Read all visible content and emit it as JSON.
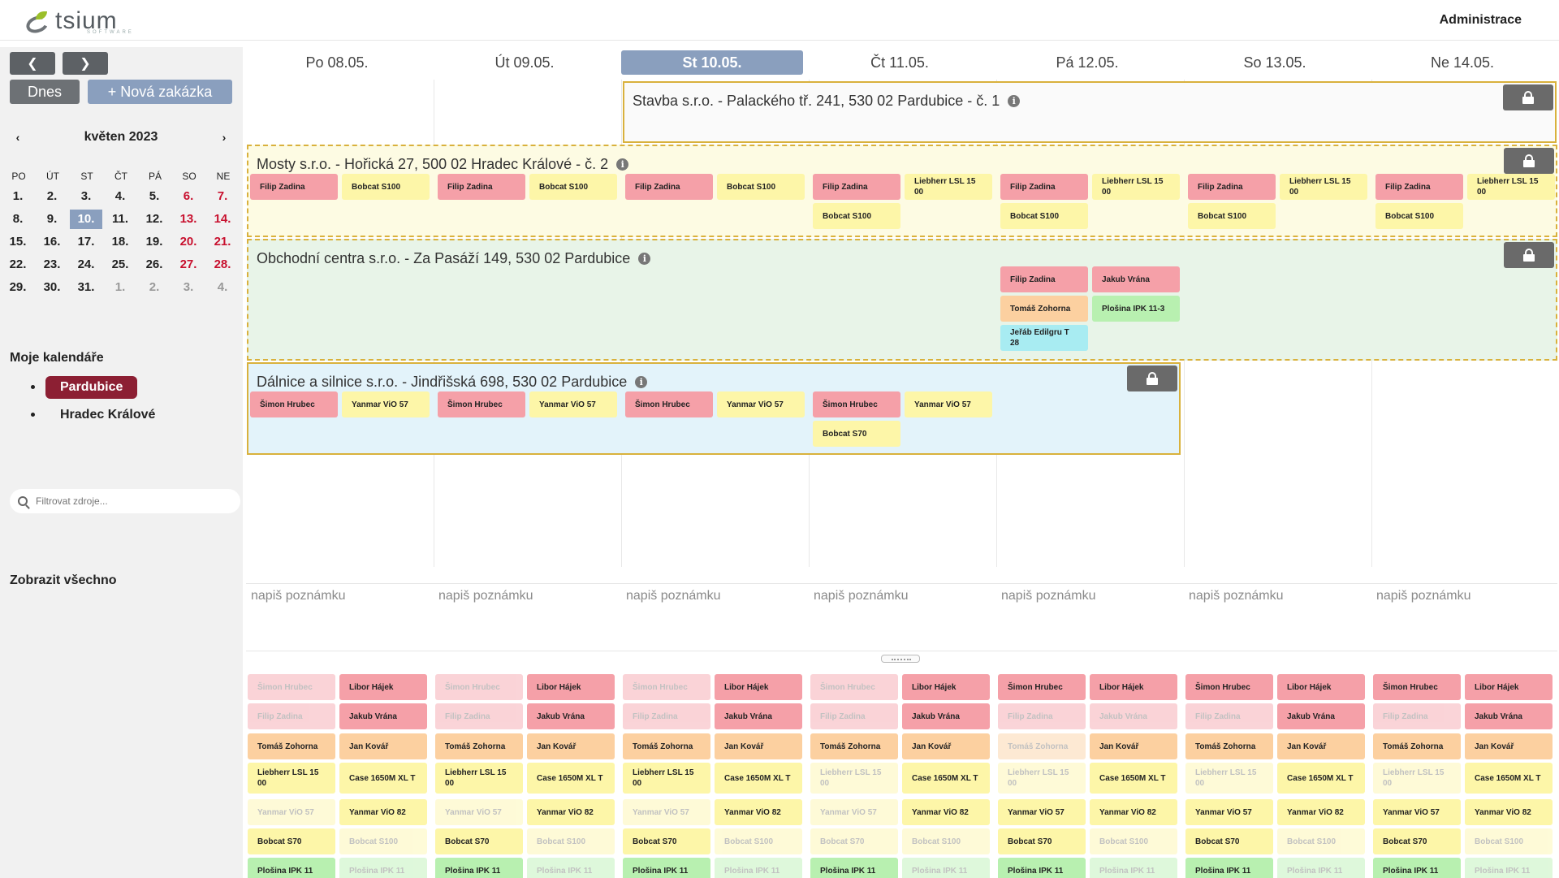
{
  "header": {
    "logo_text": "tsium",
    "logo_sub": "SOFTWARE",
    "admin": "Administrace"
  },
  "sidebar": {
    "prev_icon": "chevron-left-icon",
    "next_icon": "chevron-right-icon",
    "today_label": "Dnes",
    "new_order_label": "+ Nová zakázka",
    "month_title": "květen 2023",
    "weekdays": [
      "PO",
      "ÚT",
      "ST",
      "ČT",
      "PÁ",
      "SO",
      "NE"
    ],
    "days": [
      "1.",
      "2.",
      "3.",
      "4.",
      "5.",
      "6.",
      "7.",
      "8.",
      "9.",
      "10.",
      "11.",
      "12.",
      "13.",
      "14.",
      "15.",
      "16.",
      "17.",
      "18.",
      "19.",
      "20.",
      "21.",
      "22.",
      "23.",
      "24.",
      "25.",
      "26.",
      "27.",
      "28.",
      "29.",
      "30.",
      "31.",
      "1.",
      "2.",
      "3.",
      "4."
    ],
    "my_calendars_title": "Moje kalendáře",
    "calendars": [
      "Pardubice",
      "Hradec Králové"
    ],
    "filter_placeholder": "Filtrovat zdroje...",
    "show_all": "Zobrazit všechno"
  },
  "week": {
    "days": [
      "Po 08.05.",
      "Út 09.05.",
      "St 10.05.",
      "Čt 11.05.",
      "Pá 12.05.",
      "So 13.05.",
      "Ne 14.05."
    ],
    "current_index": 2
  },
  "projects": [
    {
      "title": "Stavba s.r.o. - Palackého tř. 241, 530 02 Pardubice - č. 1",
      "color": "#fafafa"
    },
    {
      "title": "Mosty s.r.o. - Hořická 27, 500 02 Hradec Králové - č. 2",
      "color": "#fdfbe3"
    },
    {
      "title": "Obchodní centra s.r.o. - Za Pasáží 149, 530 02 Pardubice",
      "color": "#e8f4e8"
    },
    {
      "title": "Dálnice a silnice s.r.o. - Jindřišská 698, 530 02 Pardubice",
      "color": "#e3f3fa"
    }
  ],
  "names": {
    "filip": "Filip Zadina",
    "bobcat100": "Bobcat S100",
    "liebherr": "Liebherr LSL 15 00",
    "jakub": "Jakub Vrána",
    "tomas": "Tomáš Zohorna",
    "plosina": "Plošina IPK 11-3",
    "jerab": "Jeřáb Edilgru T 28",
    "simon": "Šimon Hrubec",
    "yanmar57": "Yanmar ViO 57",
    "bobcat70": "Bobcat S70",
    "libor": "Libor Hájek",
    "jan": "Jan Kovář",
    "case": "Case 1650M XL T",
    "yanmar82": "Yanmar ViO 82",
    "plosina_partial": "Plošina IPK 11"
  },
  "note_placeholder": "napiš poznámku",
  "colors": {
    "accent": "#8a9fbe",
    "active_calendar": "#8c1f33",
    "weekend": "#c8102e"
  }
}
